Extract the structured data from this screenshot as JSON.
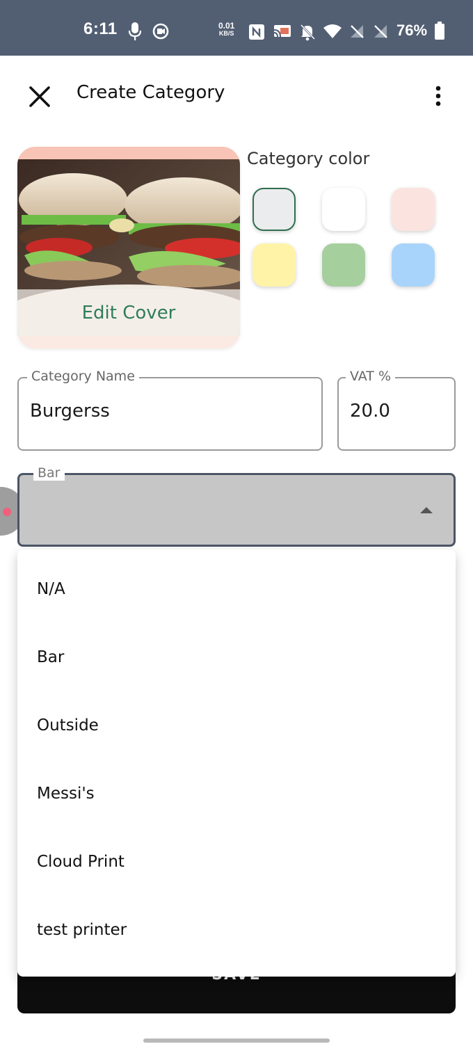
{
  "status_bar": {
    "time": "6:11",
    "net_speed_value": "0.01",
    "net_speed_unit": "KB/S",
    "battery": "76%"
  },
  "header": {
    "title": "Create Category"
  },
  "cover": {
    "edit_label": "Edit Cover"
  },
  "color_picker": {
    "title": "Category color",
    "swatches": [
      "#ebeced",
      "#ffffff",
      "#fbe4df",
      "#fff3a8",
      "#a6cf9e",
      "#a8d4fb"
    ],
    "selected_index": 0
  },
  "form": {
    "category_name_label": "Category Name",
    "category_name_value": "Burgerss",
    "vat_label": "VAT %",
    "vat_value": "20.0",
    "printer_label": "Bar"
  },
  "menu": {
    "items": [
      "N/A",
      "Bar",
      "Outside",
      "Messi's",
      "Cloud Print",
      "test printer"
    ]
  },
  "save_button": {
    "label": "SAVE"
  }
}
